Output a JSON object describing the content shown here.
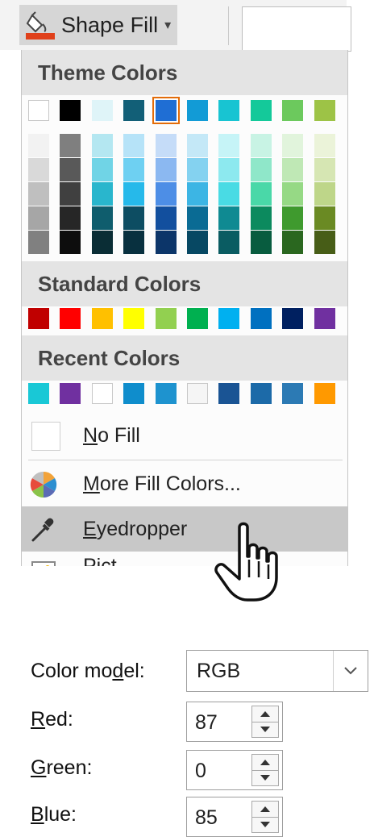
{
  "toolbar": {
    "shape_fill_label": "Shape Fill",
    "shape_fill_icon": "paint-bucket-icon",
    "fill_bar_color": "#e0401a"
  },
  "palette": {
    "theme_title": "Theme Colors",
    "theme_colors": [
      "#ffffff",
      "#000000",
      "#dff4f8",
      "#125f77",
      "#1f6ed4",
      "#129bd6",
      "#18c4d2",
      "#14c99a",
      "#6cc95d",
      "#9dc346"
    ],
    "selected_theme_index": 4,
    "theme_shades": [
      [
        "#f2f2f2",
        "#d9d9d9",
        "#bfbfbf",
        "#a6a6a6",
        "#808080"
      ],
      [
        "#7f7f7f",
        "#595959",
        "#404040",
        "#262626",
        "#0d0d0d"
      ],
      [
        "#b4e7f1",
        "#70d4e6",
        "#29b6cd",
        "#0f5d6d",
        "#0a2d35"
      ],
      [
        "#b6e3f8",
        "#6ed0f2",
        "#26b9ea",
        "#0d4d62",
        "#08303f"
      ],
      [
        "#c5dcf8",
        "#8bb8f1",
        "#4d8ee6",
        "#124f9e",
        "#0c3569"
      ],
      [
        "#c4e8f7",
        "#84d2f0",
        "#3cb5e4",
        "#0a6b94",
        "#074863"
      ],
      [
        "#c6f4f7",
        "#8de9ef",
        "#49dbe4",
        "#0f8a92",
        "#0a5c62"
      ],
      [
        "#c8f3e4",
        "#8fe7c9",
        "#4ad8a8",
        "#0c8a5e",
        "#085c3f"
      ],
      [
        "#e1f4dc",
        "#bfe8b5",
        "#96d985",
        "#3f9a2e",
        "#2a671f"
      ],
      [
        "#ebf3d9",
        "#d6e6b3",
        "#bed689",
        "#6a8a23",
        "#475d17"
      ]
    ],
    "standard_title": "Standard Colors",
    "standard_colors": [
      "#c00000",
      "#ff0000",
      "#ffc000",
      "#ffff00",
      "#92d050",
      "#00b050",
      "#00b0f0",
      "#0070c0",
      "#002060",
      "#7030a0"
    ],
    "recent_title": "Recent Colors",
    "recent_colors": [
      "#19c8d6",
      "#7030a0",
      "#ffffff",
      "#0f8dcc",
      "#1e93cf",
      "#f5f5f5",
      "#1a5494",
      "#1c6aa8",
      "#2c7ab4",
      "#ff9900"
    ]
  },
  "menu": {
    "no_fill_u": "N",
    "no_fill_rest": "o Fill",
    "more_u": "M",
    "more_rest": "ore Fill Colors...",
    "eyedropper_u": "E",
    "eyedropper_rest": "yedropper",
    "picture_partial": "Pict"
  },
  "icons": {
    "no_fill": "empty-square-icon",
    "more_colors": "color-wheel-icon",
    "eyedropper": "eyedropper-icon",
    "picture": "picture-icon",
    "cursor": "hand-pointer-icon",
    "dropdown": "chevron-down-icon"
  },
  "dialog": {
    "color_model_pre": "Color mo",
    "color_model_u": "d",
    "color_model_post": "el:",
    "color_model_value": "RGB",
    "red_u": "R",
    "red_rest": "ed:",
    "red_value": "87",
    "green_u": "G",
    "green_rest": "reen:",
    "green_value": "0",
    "blue_u": "B",
    "blue_rest": "lue:",
    "blue_value": "85"
  }
}
